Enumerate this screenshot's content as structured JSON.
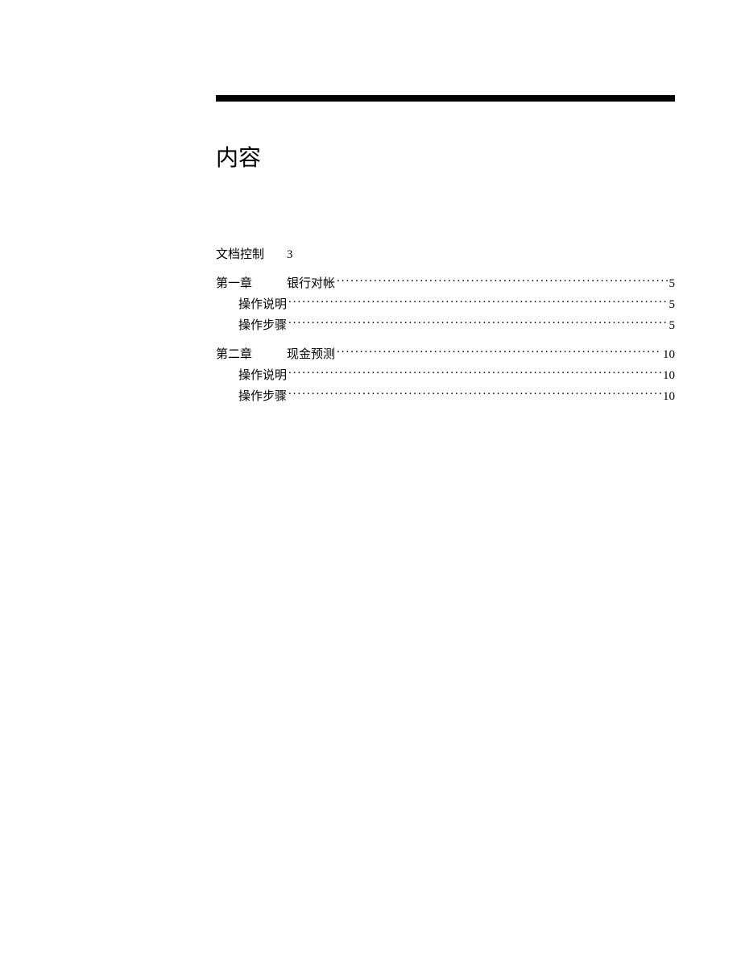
{
  "title": "内容",
  "docControl": {
    "label": "文档控制",
    "page": "3"
  },
  "chapters": [
    {
      "chapterLabel": "第一章",
      "title": "银行对帐",
      "page": "5",
      "subs": [
        {
          "title": "操作说明",
          "page": "5"
        },
        {
          "title": "操作步骤",
          "page": "5"
        }
      ]
    },
    {
      "chapterLabel": "第二章",
      "title": "现金预测",
      "page": "10",
      "subs": [
        {
          "title": "操作说明",
          "page": "10"
        },
        {
          "title": "操作步骤",
          "page": "10"
        }
      ]
    }
  ]
}
